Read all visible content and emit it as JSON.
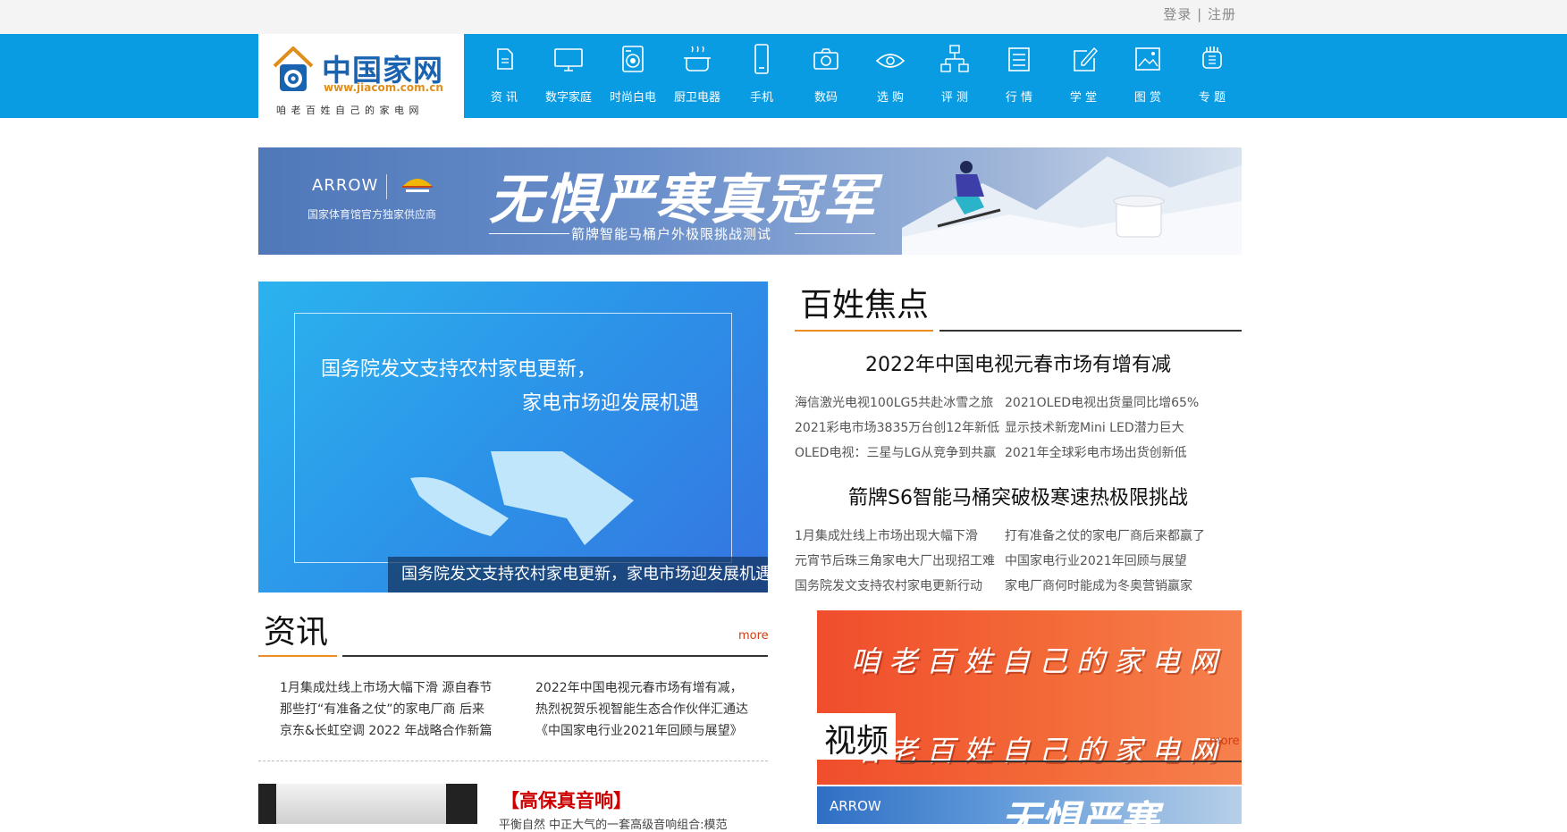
{
  "topbar": {
    "login": "登录",
    "sep": "|",
    "register": "注册"
  },
  "logo": {
    "name": "中国家网",
    "url": "www.jiacom.com.cn",
    "slogan": "咱老百姓自己的家电网"
  },
  "nav": [
    {
      "label": "资 讯",
      "icon": "document-icon"
    },
    {
      "label": "数字家庭",
      "icon": "monitor-icon"
    },
    {
      "label": "时尚白电",
      "icon": "washing-machine-icon"
    },
    {
      "label": "厨卫电器",
      "icon": "cooking-pot-icon"
    },
    {
      "label": "手机",
      "icon": "phone-icon"
    },
    {
      "label": "数码",
      "icon": "camera-icon"
    },
    {
      "label": "选 购",
      "icon": "eye-icon"
    },
    {
      "label": "评 测",
      "icon": "network-icon"
    },
    {
      "label": "行 情",
      "icon": "list-icon"
    },
    {
      "label": "学 堂",
      "icon": "edit-icon"
    },
    {
      "label": "图 赏",
      "icon": "image-icon"
    },
    {
      "label": "专 题",
      "icon": "hand-icon"
    }
  ],
  "banner": {
    "brand": "ARROW",
    "sub": "国家体育馆官方独家供应商",
    "title": "无惧严寒真冠军",
    "tagline": "箭牌智能马桶户外极限挑战测试"
  },
  "hero": {
    "line1": "国务院发文支持农村家电更新，",
    "line2": "家电市场迎发展机遇",
    "caption": "国务院发文支持农村家电更新，家电市场迎发展机遇"
  },
  "focus": {
    "title": "百姓焦点",
    "headline1": "2022年中国电视元春市场有增有减",
    "group1": [
      [
        "海信激光电视100LG5共赴冰雪之旅",
        "2021OLED电视出货量同比增65%"
      ],
      [
        "2021彩电市场3835万台创12年新低",
        "显示技术新宠Mini LED潜力巨大"
      ],
      [
        "OLED电视：三星与LG从竞争到共赢",
        "2021年全球彩电市场出货创新低"
      ]
    ],
    "headline2": "箭牌S6智能马桶突破极寒速热极限挑战",
    "group2": [
      [
        "1月集成灶线上市场出现大幅下滑",
        "打有准备之仗的家电厂商后来都赢了"
      ],
      [
        "元宵节后珠三角家电大厂出现招工难",
        "中国家电行业2021年回顾与展望"
      ],
      [
        "国务院发文支持农村家电更新行动",
        "家电厂商何时能成为冬奥营销赢家"
      ]
    ]
  },
  "news": {
    "title": "资讯",
    "more": "more",
    "rows": [
      [
        "1月集成灶线上市场大幅下滑 源自春节",
        "2022年中国电视元春市场有增有减，"
      ],
      [
        "那些打“有准备之仗”的家电厂商 后来",
        "热烈祝贺乐视智能生态合作伙伴汇通达"
      ],
      [
        "京东&长虹空调 2022 年战略合作新篇",
        "《中国家电行业2021年回顾与展望》"
      ]
    ]
  },
  "audio": {
    "title": "【高保真音响】",
    "desc": "平衡自然 中正大气的一套高级音响组合:模范"
  },
  "slogan_ad": {
    "text1": "咱老百姓自己的家电网",
    "text2": "咱老百姓自己的家电网"
  },
  "video": {
    "title": "视频",
    "more": "more"
  },
  "arrow_ad2": {
    "brand": "ARROW",
    "title": "无惧严寒"
  }
}
